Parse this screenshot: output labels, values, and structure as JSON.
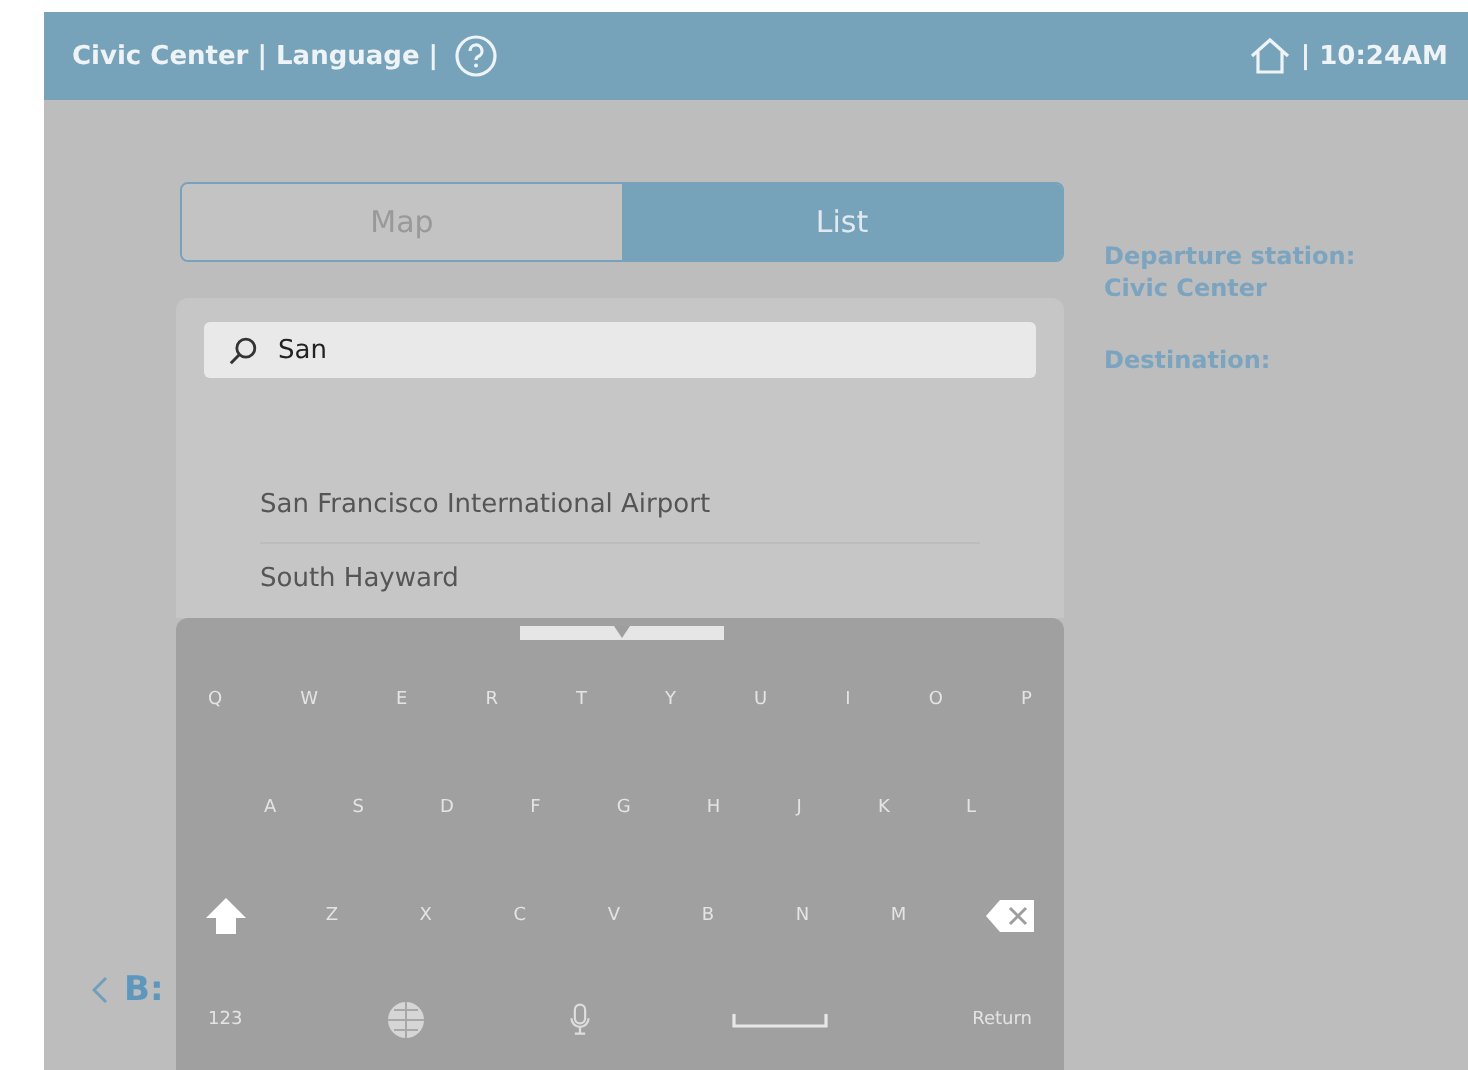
{
  "header": {
    "title": "Civic Center | Language |",
    "time": "| 10:24AM"
  },
  "view_tabs": [
    {
      "label": "Map",
      "selected": false
    },
    {
      "label": "List",
      "selected": true
    }
  ],
  "search": {
    "value": "San"
  },
  "results": [
    "San Francisco International Airport",
    "South Hayward"
  ],
  "trip": [
    {
      "label": "Departure station:",
      "value": "Civic Center"
    },
    {
      "label": "Destination:"
    }
  ],
  "back": {
    "label": "B:"
  },
  "keyboard": {
    "rows": [
      [
        {
          "kind": "char",
          "label": "Q"
        },
        {
          "kind": "char",
          "label": "W"
        },
        {
          "kind": "char",
          "label": "E"
        },
        {
          "kind": "char",
          "label": "R"
        },
        {
          "kind": "char",
          "label": "T"
        },
        {
          "kind": "char",
          "label": "Y"
        },
        {
          "kind": "char",
          "label": "U"
        },
        {
          "kind": "char",
          "label": "I"
        },
        {
          "kind": "char",
          "label": "O"
        },
        {
          "kind": "char",
          "label": "P"
        }
      ],
      [
        {
          "kind": "char",
          "label": "A"
        },
        {
          "kind": "char",
          "label": "S"
        },
        {
          "kind": "char",
          "label": "D"
        },
        {
          "kind": "char",
          "label": "F"
        },
        {
          "kind": "char",
          "label": "G"
        },
        {
          "kind": "char",
          "label": "H"
        },
        {
          "kind": "char",
          "label": "J"
        },
        {
          "kind": "char",
          "label": "K"
        },
        {
          "kind": "char",
          "label": "L"
        }
      ],
      [
        {
          "kind": "shift"
        },
        {
          "kind": "char",
          "label": "Z"
        },
        {
          "kind": "char",
          "label": "X"
        },
        {
          "kind": "char",
          "label": "C"
        },
        {
          "kind": "char",
          "label": "V"
        },
        {
          "kind": "char",
          "label": "B"
        },
        {
          "kind": "char",
          "label": "N"
        },
        {
          "kind": "char",
          "label": "M"
        },
        {
          "kind": "delete"
        }
      ]
    ],
    "function_keys": [
      {
        "kind": "char",
        "label": "123"
      },
      {
        "kind": "globe"
      },
      {
        "kind": "mic"
      },
      {
        "kind": "space"
      },
      {
        "kind": "char",
        "label": "Return"
      }
    ]
  }
}
